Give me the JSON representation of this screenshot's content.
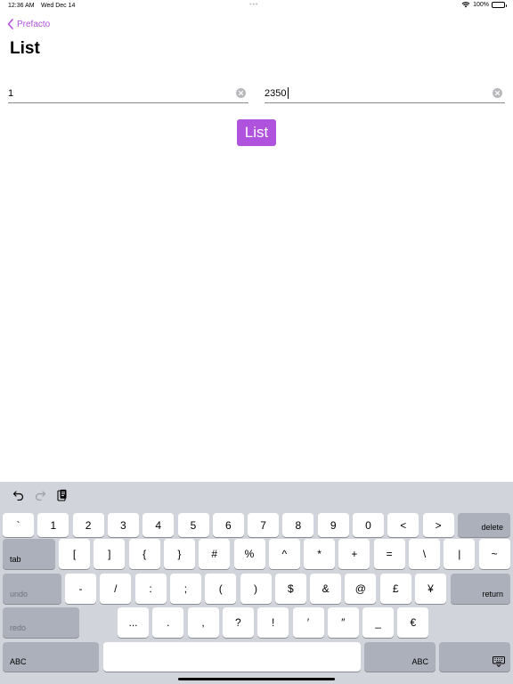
{
  "status": {
    "time": "12:36 AM",
    "date": "Wed Dec 14",
    "battery": "100%"
  },
  "nav": {
    "back_label": "Prefacto",
    "title": "List"
  },
  "fields": {
    "first_value": "1",
    "second_value": "2350"
  },
  "actions": {
    "list_button": "List"
  },
  "keyboard": {
    "row1": [
      "`",
      "1",
      "2",
      "3",
      "4",
      "5",
      "6",
      "7",
      "8",
      "9",
      "0",
      "<",
      ">"
    ],
    "delete": "delete",
    "tab": "tab",
    "row2": [
      "[",
      "]",
      "{",
      "}",
      "#",
      "%",
      "^",
      "*",
      "+",
      "=",
      "\\",
      "|",
      "~"
    ],
    "undo": "undo",
    "row3": [
      "-",
      "/",
      ":",
      ";",
      "(",
      ")",
      "$",
      "&",
      "@",
      "£",
      "¥"
    ],
    "return": "return",
    "redo": "redo",
    "row4": [
      "...",
      ".",
      ",",
      "?",
      "!",
      "′",
      "″",
      "_",
      "€"
    ],
    "abc_left": "ABC",
    "abc_right": "ABC"
  },
  "colors": {
    "accent": "#af52de",
    "keyboard_bg": "#d1d4da",
    "function_key": "#abb0ba"
  }
}
